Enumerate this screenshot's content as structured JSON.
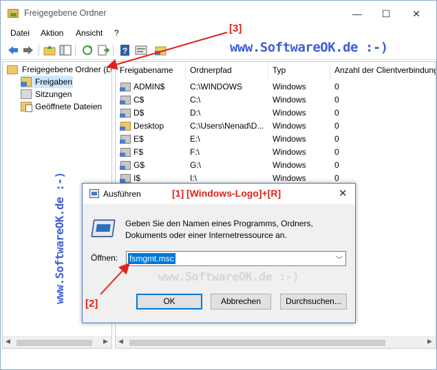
{
  "window": {
    "title": "Freigegebene Ordner",
    "controls": {
      "minimize": "—",
      "maximize": "☐",
      "close": "✕"
    }
  },
  "menu": [
    "Datei",
    "Aktion",
    "Ansicht",
    "?"
  ],
  "watermark": "www.SoftwareOK.de :-)",
  "side_watermark": "www.SoftwareOK.de :-)",
  "tree": {
    "root": "Freigegebene Ordner (Lo",
    "items": [
      "Freigaben",
      "Sitzungen",
      "Geöffnete Dateien"
    ]
  },
  "list": {
    "columns": [
      "Freigabename",
      "Ordnerpfad",
      "Typ",
      "Anzahl der Clientverbindungen"
    ],
    "rows": [
      {
        "name": "ADMIN$",
        "path": "C:\\WINDOWS",
        "type": "Windows",
        "count": "0"
      },
      {
        "name": "C$",
        "path": "C:\\",
        "type": "Windows",
        "count": "0"
      },
      {
        "name": "D$",
        "path": "D:\\",
        "type": "Windows",
        "count": "0"
      },
      {
        "name": "Desktop",
        "path": "C:\\Users\\Nenad\\D...",
        "type": "Windows",
        "count": "0"
      },
      {
        "name": "E$",
        "path": "E:\\",
        "type": "Windows",
        "count": "0"
      },
      {
        "name": "F$",
        "path": "F:\\",
        "type": "Windows",
        "count": "0"
      },
      {
        "name": "G$",
        "path": "G:\\",
        "type": "Windows",
        "count": "0"
      },
      {
        "name": "I$",
        "path": "I:\\",
        "type": "Windows",
        "count": "0"
      }
    ]
  },
  "run_dialog": {
    "title": "Ausführen",
    "annotation": "[1]  [Windows-Logo]+[R]",
    "description": "Geben Sie den Namen eines Programms, Ordners, Dokuments oder einer Internetressource an.",
    "open_label": "Öffnen:",
    "input_value": "fsmgmt.msc",
    "watermark": "www.SoftwareOK.de :-)",
    "buttons": {
      "ok": "OK",
      "cancel": "Abbrechen",
      "browse": "Durchsuchen..."
    }
  },
  "annotations": {
    "label2": "[2]",
    "label3": "[3]"
  },
  "colors": {
    "annotation_red": "#e0221c",
    "watermark_blue": "#3e5ed8",
    "selection": "#cce8ff",
    "accent": "#0078d7"
  }
}
